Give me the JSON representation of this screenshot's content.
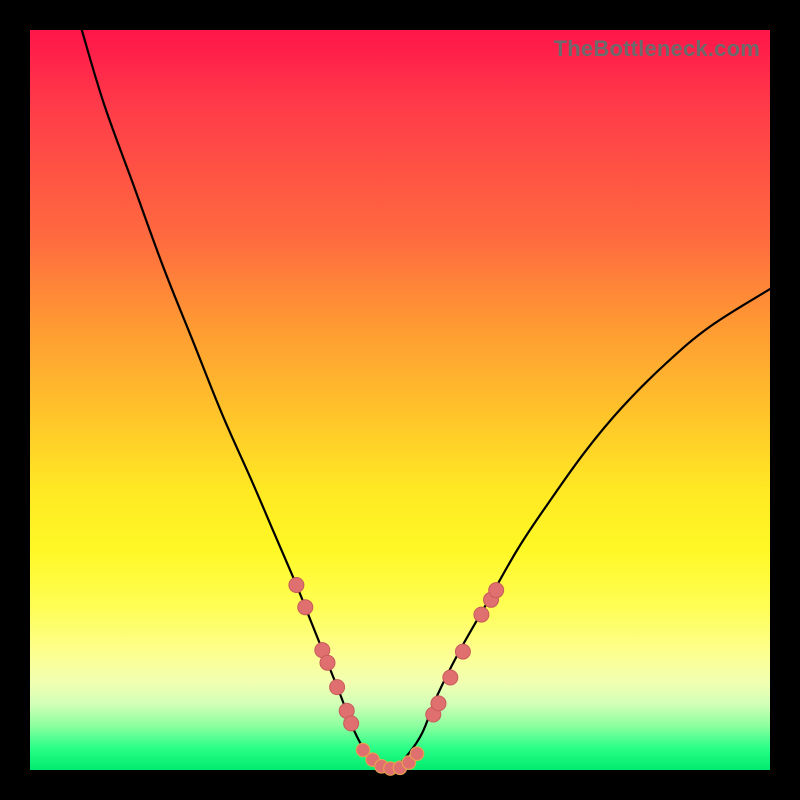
{
  "watermark": {
    "text": "TheBottleneck.com"
  },
  "colors": {
    "background": "#000000",
    "curve": "#000000",
    "marker_fill": "#e07070",
    "marker_stroke": "#c85a5a",
    "marker_stroke2": "#e9a648"
  },
  "chart_data": {
    "type": "line",
    "title": "",
    "xlabel": "",
    "ylabel": "",
    "xlim": [
      0,
      100
    ],
    "ylim": [
      0,
      100
    ],
    "grid": false,
    "legend": false,
    "series": [
      {
        "name": "bottleneck-curve",
        "x": [
          7,
          10,
          14,
          18,
          22,
          26,
          30,
          33,
          36,
          38,
          40,
          42,
          43.5,
          45,
          46.5,
          48,
          49.5,
          51,
          53,
          55,
          58,
          62,
          66,
          70,
          75,
          80,
          86,
          92,
          100
        ],
        "y": [
          100,
          90,
          79,
          68,
          58,
          48,
          39,
          32,
          25,
          20,
          15,
          10,
          6,
          3,
          1,
          0,
          0.5,
          2,
          5,
          10,
          16,
          23,
          30,
          36,
          43,
          49,
          55,
          60,
          65
        ]
      }
    ],
    "markers_left": [
      {
        "x": 36.0,
        "y": 25.0
      },
      {
        "x": 37.2,
        "y": 22.0
      },
      {
        "x": 39.5,
        "y": 16.2
      },
      {
        "x": 40.2,
        "y": 14.5
      },
      {
        "x": 41.5,
        "y": 11.2
      },
      {
        "x": 42.8,
        "y": 8.0
      },
      {
        "x": 43.4,
        "y": 6.3
      }
    ],
    "markers_bottom": [
      {
        "x": 45.0,
        "y": 2.7
      },
      {
        "x": 46.3,
        "y": 1.4
      },
      {
        "x": 47.5,
        "y": 0.5
      },
      {
        "x": 48.7,
        "y": 0.2
      },
      {
        "x": 50.0,
        "y": 0.3
      },
      {
        "x": 51.2,
        "y": 1.0
      },
      {
        "x": 52.3,
        "y": 2.2
      }
    ],
    "markers_right": [
      {
        "x": 54.5,
        "y": 7.5
      },
      {
        "x": 55.2,
        "y": 9.0
      },
      {
        "x": 56.8,
        "y": 12.5
      },
      {
        "x": 58.5,
        "y": 16.0
      },
      {
        "x": 61.0,
        "y": 21.0
      },
      {
        "x": 62.3,
        "y": 23.0
      },
      {
        "x": 63.0,
        "y": 24.3
      }
    ]
  }
}
